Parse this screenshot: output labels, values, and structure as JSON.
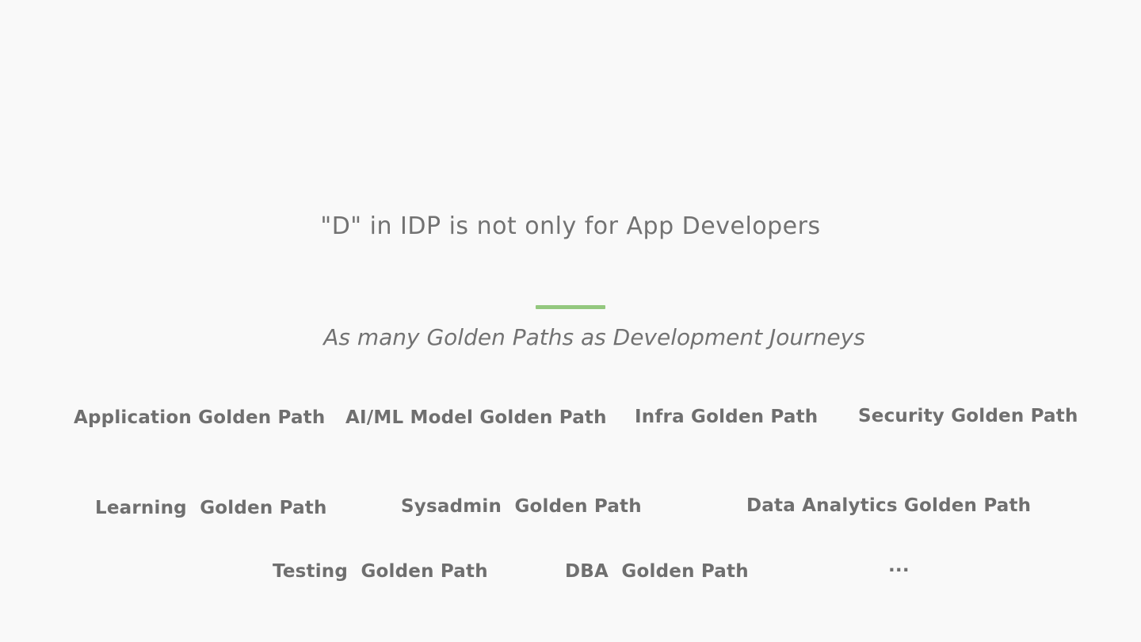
{
  "slide": {
    "title": "\"D\" in IDP is not only for App Developers",
    "subtitle": "As many Golden Paths as Development Journeys",
    "accent_color": "#94c87f",
    "text_color": "#727272",
    "background_color": "#f9f9f9",
    "paths": [
      "Application Golden Path",
      "AI/ML Model Golden Path",
      "Infra Golden Path",
      "Security Golden Path",
      "Learning  Golden Path",
      "Sysadmin  Golden Path",
      "Data Analytics Golden Path",
      "Testing  Golden Path",
      "DBA  Golden Path",
      "..."
    ]
  }
}
